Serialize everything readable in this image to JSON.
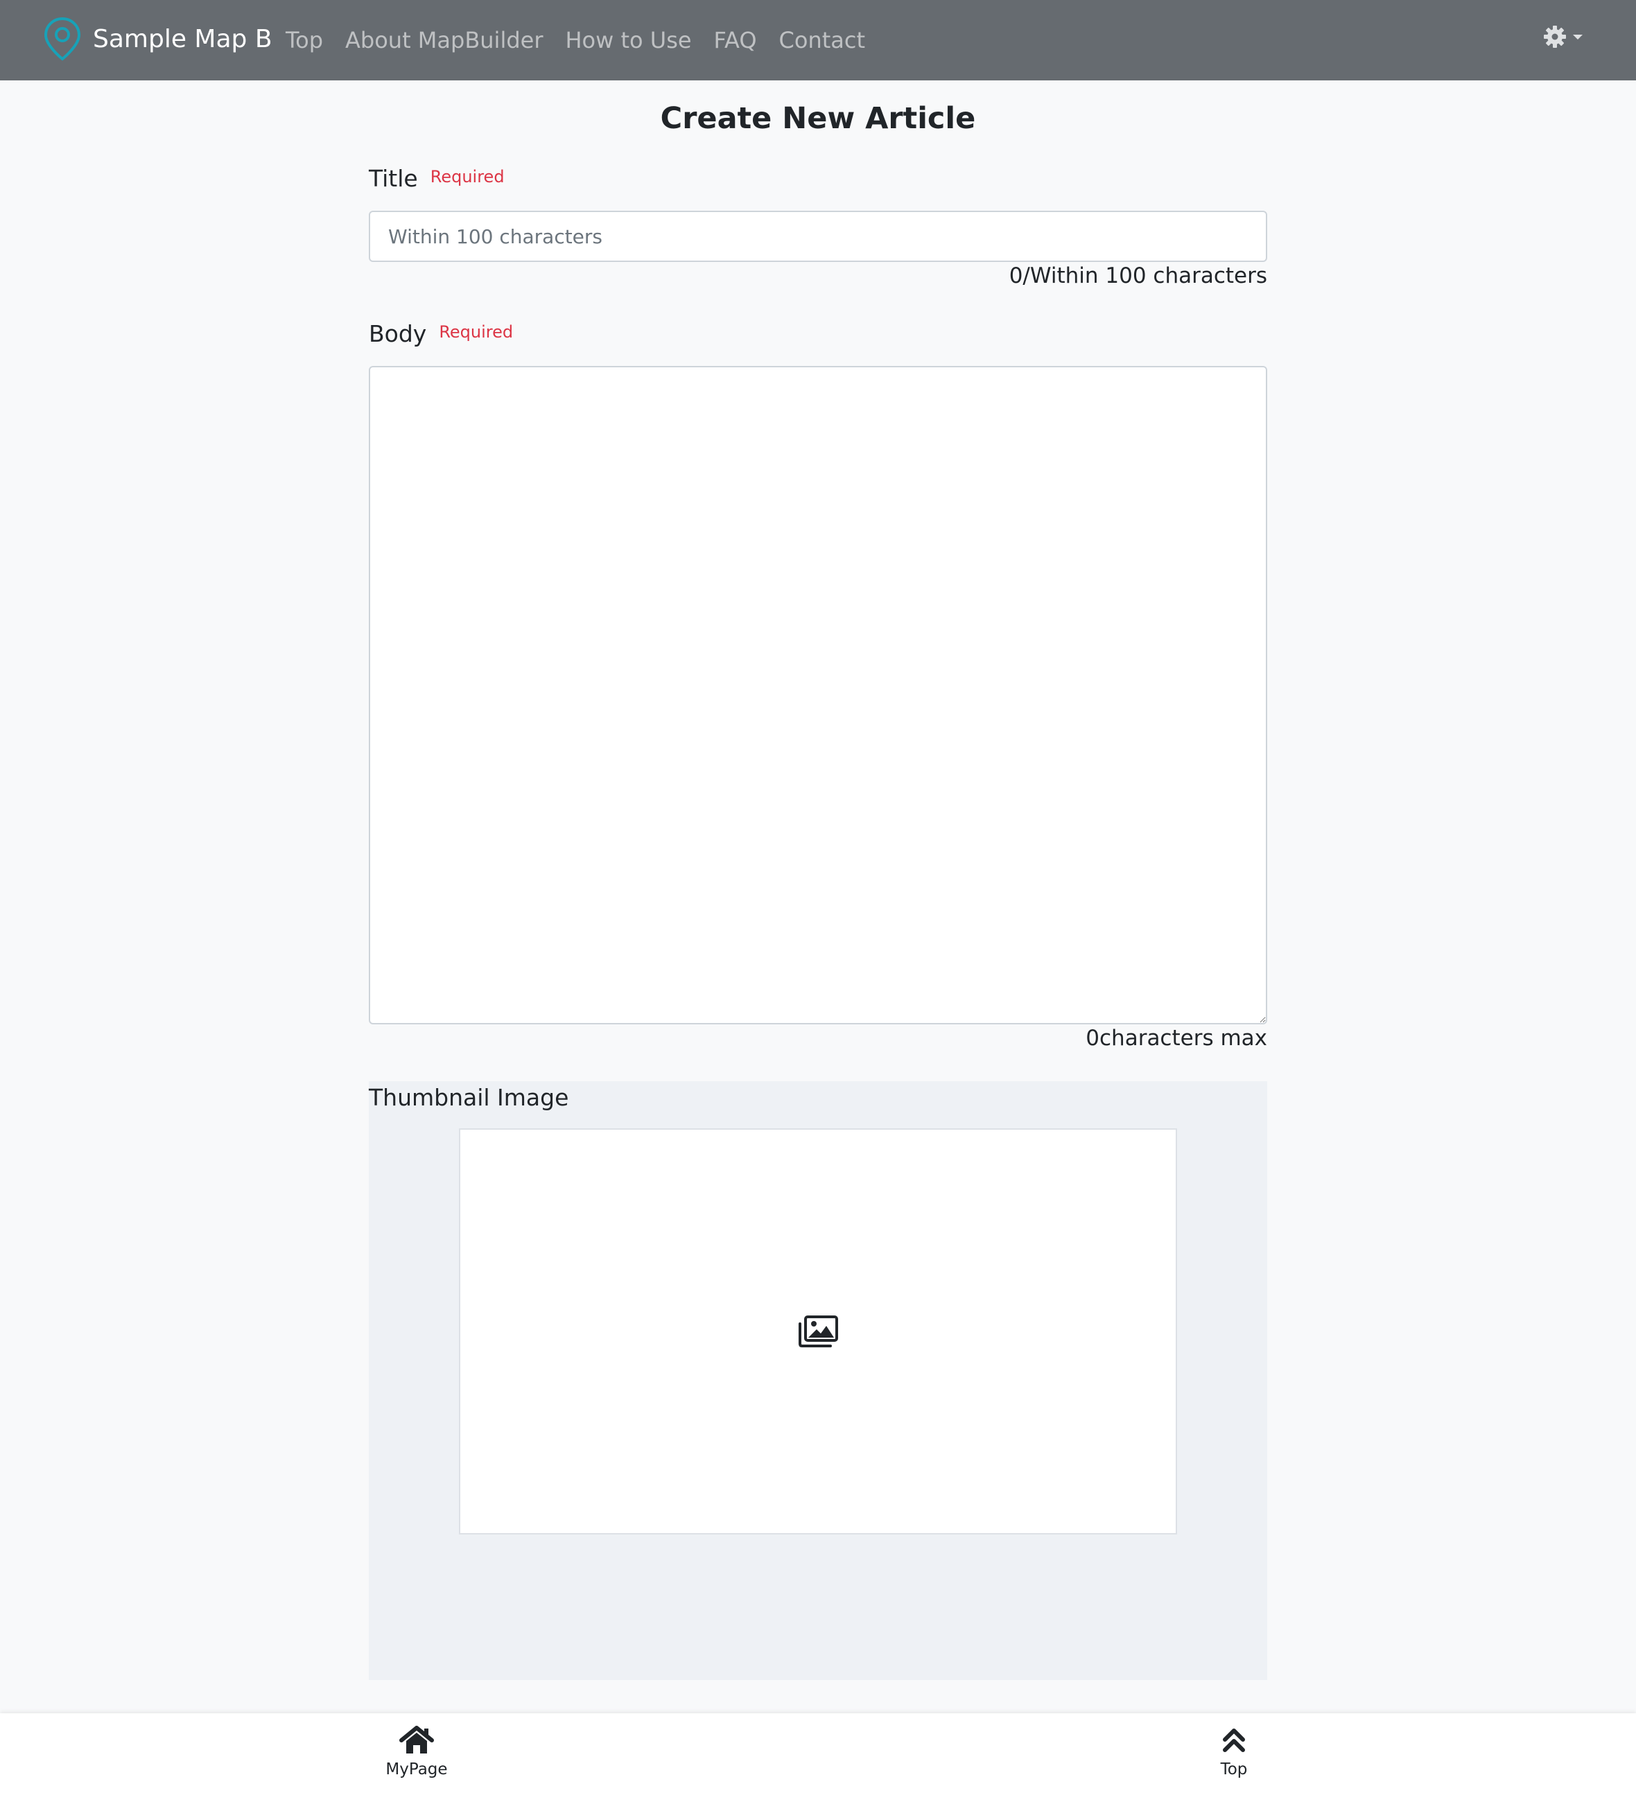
{
  "navbar": {
    "brand": "Sample Map B",
    "brand_icon": "map-pin-icon",
    "links": [
      "Top",
      "About MapBuilder",
      "How to Use",
      "FAQ",
      "Contact"
    ],
    "settings_icon": "gear-icon",
    "colors": {
      "background": "#666b70",
      "brand_icon": "#17a2b8"
    }
  },
  "main": {
    "title": "Create New Article",
    "title_field": {
      "label": "Title",
      "required": "Required",
      "placeholder": "Within 100 characters",
      "value": "",
      "counter": "0/Within 100 characters"
    },
    "body_field": {
      "label": "Body",
      "required": "Required",
      "value": "",
      "counter": "0characters max"
    },
    "thumbnail": {
      "label": "Thumbnail Image",
      "icon": "images-icon"
    }
  },
  "bottom_bar": {
    "mypage_label": "MyPage",
    "mypage_icon": "home-icon",
    "top_label": "Top",
    "top_icon": "double-chevron-up-icon"
  }
}
